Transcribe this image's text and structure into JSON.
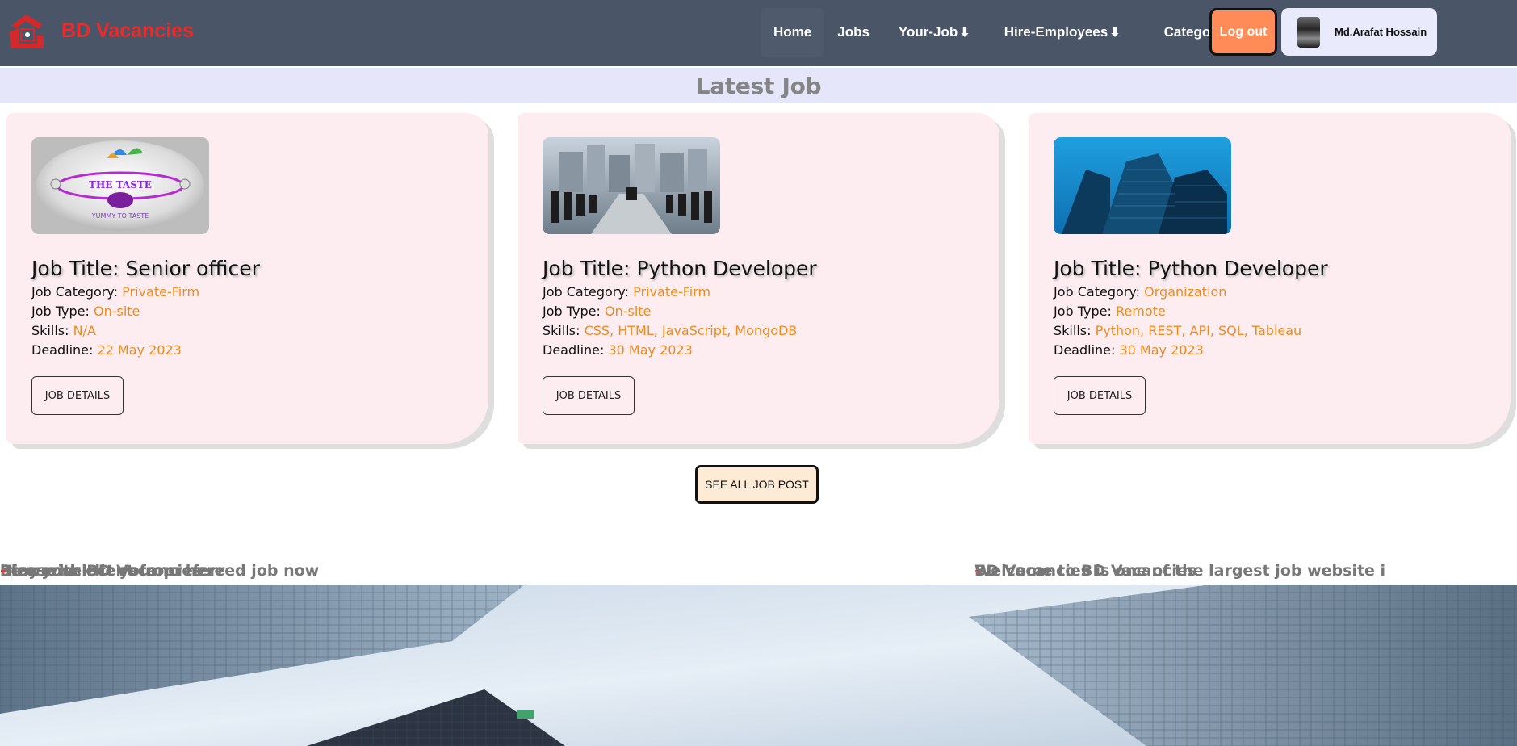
{
  "brand": {
    "name": "BD Vacancies",
    "logo_icon": "bd-vacancies-logo-icon"
  },
  "nav": {
    "items": [
      {
        "label": "Home",
        "dropdown": false
      },
      {
        "label": "Jobs",
        "dropdown": false
      },
      {
        "label": "Your-Job",
        "dropdown": true
      },
      {
        "label": "Hire-Employees",
        "dropdown": true
      },
      {
        "label": "Category",
        "dropdown": true
      }
    ],
    "dropdown_arrow": "⬇",
    "logout_label": "Log out",
    "user_name": "Md.Arafat Hossain"
  },
  "section": {
    "title": "Latest Job"
  },
  "labels": {
    "title_prefix": "Job Title: ",
    "category": "Job Category: ",
    "type": "Job Type: ",
    "skills": "Skills: ",
    "deadline": "Deadline: ",
    "details_button": "JOB DETAILS"
  },
  "jobs": [
    {
      "title": "Senior officer",
      "category": "Private-Firm",
      "type": "On-site",
      "skills": "N/A",
      "deadline": "22 May 2023",
      "image": "the-taste-logo-image"
    },
    {
      "title": "Python Developer",
      "category": "Private-Firm",
      "type": "On-site",
      "skills": "CSS, HTML, JavaScript, MongoDB",
      "deadline": "30 May 2023",
      "image": "conference-room-image"
    },
    {
      "title": "Python Developer",
      "category": "Organization",
      "type": "Remote",
      "skills": "Python, REST, API, SQL, Tableau",
      "deadline": "30 May 2023",
      "image": "glass-building-image"
    }
  ],
  "see_all_label": "SEE ALL JOB POST",
  "marquee": {
    "part1": [
      "he world",
      "Please select your preferred job now",
      "Hire your client from here",
      "Stay with BD Vacancies"
    ],
    "part2": [
      "Welcome to BD Vacancies",
      "BD Vacancies is one of the largest job website i"
    ],
    "separator": "-"
  },
  "colors": {
    "navbar": "#4a5567",
    "brand": "#ea2b2b",
    "logout": "#ff8c57",
    "card_bg": "#fdedf1",
    "value_orange": "#ef8b1e",
    "section_bg": "#e6e6fa"
  }
}
